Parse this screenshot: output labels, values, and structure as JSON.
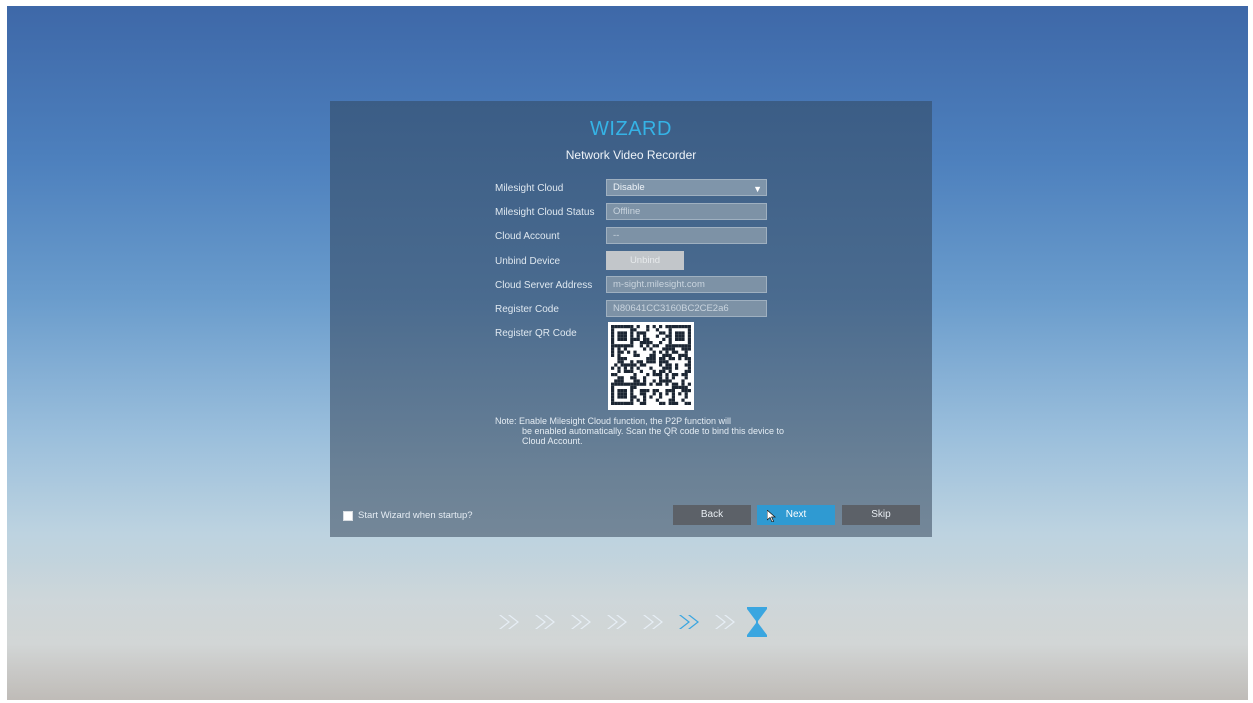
{
  "wizard": {
    "title": "WIZARD",
    "subtitle": "Network Video Recorder"
  },
  "form": {
    "milesight_cloud": {
      "label": "Milesight Cloud",
      "value": "Disable"
    },
    "cloud_status": {
      "label": "Milesight Cloud Status",
      "value": "Offline"
    },
    "cloud_account": {
      "label": "Cloud Account",
      "value": "--"
    },
    "unbind_device": {
      "label": "Unbind Device",
      "button": "Unbind"
    },
    "server_address": {
      "label": "Cloud Server Address",
      "value": "m-sight.milesight.com"
    },
    "register_code": {
      "label": "Register Code",
      "value": "N80641CC3160BC2CE2a6"
    },
    "register_qr": {
      "label": "Register QR Code"
    }
  },
  "note": {
    "prefix": "Note: Enable Milesight Cloud function, the P2P function will",
    "rest": "be enabled automatically. Scan the QR code to bind this device to Cloud Account."
  },
  "footer": {
    "startup_checkbox_label": "Start Wizard when startup?",
    "startup_checked": false,
    "back_label": "Back",
    "next_label": "Next",
    "skip_label": "Skip"
  },
  "progress": {
    "total_steps": 8,
    "current_step": 6,
    "step_icon": "double-chevron-icon",
    "end_icon": "hourglass-icon"
  },
  "colors": {
    "accent": "#35b3e6",
    "next_button": "#2f9ad2",
    "secondary_button": "#5c6168",
    "inactive_step": "#e6eef5",
    "active_step": "#3aa6e0"
  }
}
